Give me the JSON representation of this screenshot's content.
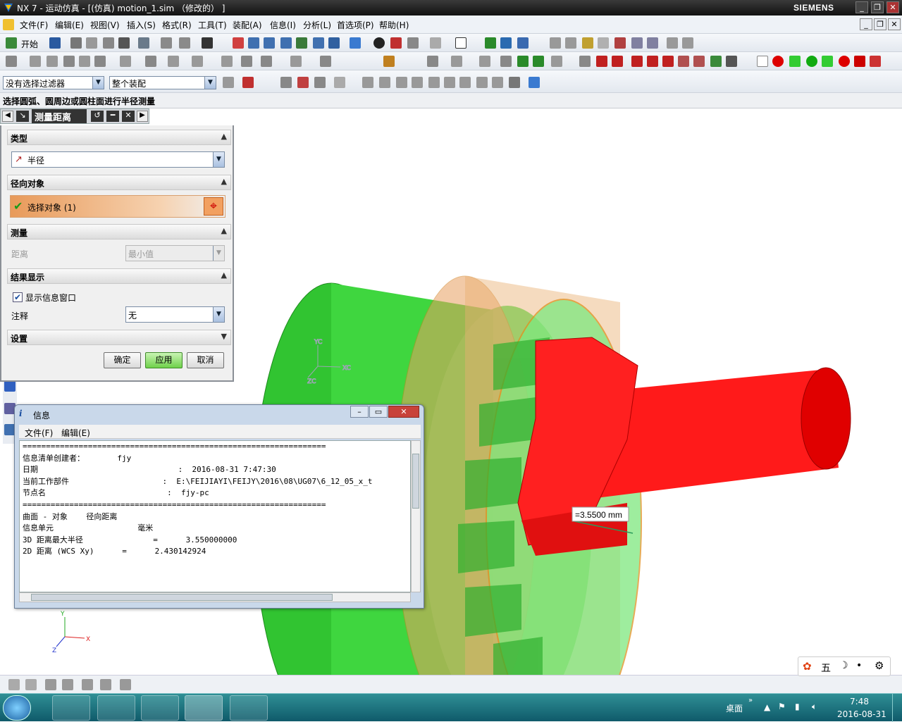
{
  "window": {
    "title": "NX 7 - 运动仿真 - [(仿真) motion_1.sim （修改的） ]",
    "brand": "SIEMENS"
  },
  "menu": [
    "文件(F)",
    "编辑(E)",
    "视图(V)",
    "插入(S)",
    "格式(R)",
    "工具(T)",
    "装配(A)",
    "信息(I)",
    "分析(L)",
    "首选项(P)",
    "帮助(H)"
  ],
  "toolbar": {
    "start_label": "开始",
    "filter_value": "没有选择过滤器",
    "assembly_value": "整个装配"
  },
  "cue_line": "选择圆弧、圆周边或圆柱面进行半径测量",
  "measure_dialog": {
    "title": "测量距离",
    "type_section": "类型",
    "type_value": "半径",
    "radial_section": "径向对象",
    "select_label": "选择对象 (1)",
    "measure_section": "测量",
    "distance_label": "距离",
    "distance_value": "最小值",
    "results_section": "结果显示",
    "show_info_label": "显示信息窗口",
    "show_info_checked": true,
    "annotation_label": "注释",
    "annotation_value": "无",
    "settings_section": "设置",
    "ok": "确定",
    "apply": "应用",
    "cancel": "取消"
  },
  "viewport": {
    "measurement_label": "=3.5500 mm",
    "wcs": {
      "x": "XC",
      "y": "YC",
      "z": "ZC"
    },
    "abs": {
      "x": "X",
      "y": "Y",
      "z": "Z"
    }
  },
  "info_window": {
    "title": "信息",
    "menu_file": "文件(F)",
    "menu_edit": "编辑(E)",
    "lines": [
      "=================================================================",
      "信息清单创建者：       fjy",
      "日期                              :  2016-08-31 7:47:30",
      "当前工作部件                    :  E:\\FEIJIAYI\\FEIJY\\2016\\08\\UG07\\6_12_05_x_t",
      "节点名                          :  fjy-pc",
      "=================================================================",
      "曲面 - 对象    径向距离",
      "",
      "信息单元                  毫米",
      "",
      "3D 距离最大半径               =      3.550000000",
      "",
      "2D 距离 (WCS Xy)      =      2.430142924"
    ]
  },
  "taskbar": {
    "desktop_label": "桌面",
    "time": "7:48",
    "date": "2016-08-31",
    "ime": "五"
  },
  "colors": {
    "accent": "#2e8b96",
    "green_part": "#3fd63f",
    "red_part": "#ff1a1a",
    "orange_part": "#e8a060"
  }
}
